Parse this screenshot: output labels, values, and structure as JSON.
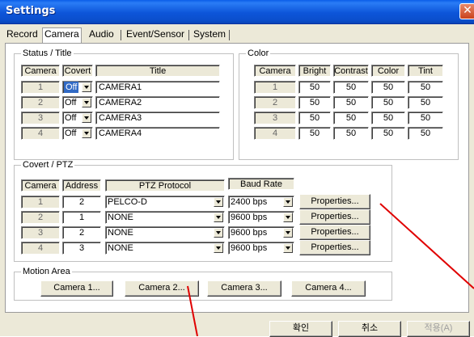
{
  "window": {
    "title": "Settings",
    "close_glyph": "✕"
  },
  "tabs": [
    {
      "label": "Record"
    },
    {
      "label": "Camera"
    },
    {
      "label": "Audio"
    },
    {
      "label": "Event/Sensor"
    },
    {
      "label": "System"
    }
  ],
  "status_title": {
    "legend": "Status / Title",
    "headers": {
      "camera": "Camera",
      "covert": "Covert",
      "title": "Title"
    },
    "rows": [
      {
        "camera": "1",
        "covert": "Off",
        "title": "CAMERA1",
        "covert_selected": true
      },
      {
        "camera": "2",
        "covert": "Off",
        "title": "CAMERA2",
        "covert_selected": false
      },
      {
        "camera": "3",
        "covert": "Off",
        "title": "CAMERA3",
        "covert_selected": false
      },
      {
        "camera": "4",
        "covert": "Off",
        "title": "CAMERA4",
        "covert_selected": false
      }
    ]
  },
  "color": {
    "legend": "Color",
    "headers": {
      "camera": "Camera",
      "bright": "Bright",
      "contrast": "Contrast",
      "color": "Color",
      "tint": "Tint"
    },
    "rows": [
      {
        "camera": "1",
        "bright": "50",
        "contrast": "50",
        "color": "50",
        "tint": "50"
      },
      {
        "camera": "2",
        "bright": "50",
        "contrast": "50",
        "color": "50",
        "tint": "50"
      },
      {
        "camera": "3",
        "bright": "50",
        "contrast": "50",
        "color": "50",
        "tint": "50"
      },
      {
        "camera": "4",
        "bright": "50",
        "contrast": "50",
        "color": "50",
        "tint": "50"
      }
    ]
  },
  "covert_ptz": {
    "legend": "Covert / PTZ",
    "headers": {
      "camera": "Camera",
      "address": "Address",
      "protocol": "PTZ Protocol",
      "baud": "Baud Rate"
    },
    "rows": [
      {
        "camera": "1",
        "address": "2",
        "protocol": "PELCO-D",
        "baud": "2400 bps",
        "button": "Properties..."
      },
      {
        "camera": "2",
        "address": "1",
        "protocol": "NONE",
        "baud": "9600 bps",
        "button": "Properties..."
      },
      {
        "camera": "3",
        "address": "2",
        "protocol": "NONE",
        "baud": "9600 bps",
        "button": "Properties..."
      },
      {
        "camera": "4",
        "address": "3",
        "protocol": "NONE",
        "baud": "9600 bps",
        "button": "Properties..."
      }
    ]
  },
  "motion_area": {
    "legend": "Motion Area",
    "buttons": [
      "Camera 1...",
      "Camera 2...",
      "Camera 3...",
      "Camera 4..."
    ]
  },
  "footer": {
    "ok": "확인",
    "cancel": "취소",
    "apply": "적용(A)"
  },
  "annotation": {
    "line_color": "#e00000"
  }
}
